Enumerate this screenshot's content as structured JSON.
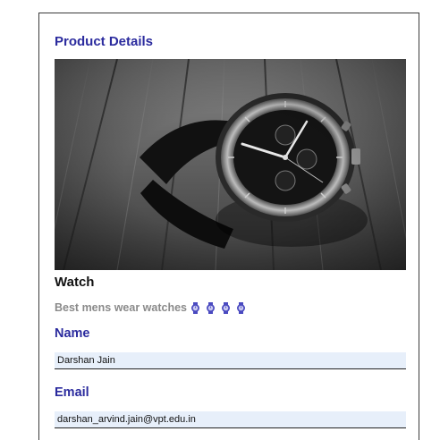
{
  "card": {
    "title": "Product Details",
    "image_alt": "watch-photo",
    "product_name": "Watch",
    "description": "Best mens wear watches",
    "rating_icons": [
      "watch-icon",
      "watch-icon",
      "watch-icon",
      "watch-icon"
    ],
    "rating_color": "#4a4ac0"
  },
  "form": {
    "name_label": "Name",
    "name_value": "Darshan Jain",
    "email_label": "Email",
    "email_value": "darshan_arvind.jain@vpt.edu.in"
  },
  "colors": {
    "heading": "#2b2b9e",
    "field_bg": "#e7effa"
  }
}
